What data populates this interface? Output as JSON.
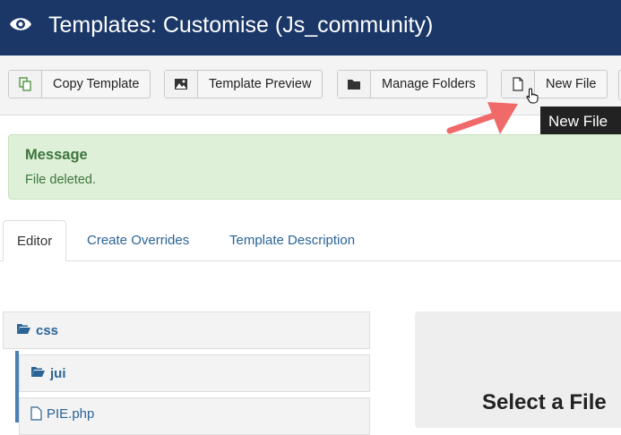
{
  "header": {
    "title": "Templates: Customise (Js_community)",
    "icon": "eye-icon"
  },
  "toolbar": {
    "buttons": [
      {
        "label": "Copy Template",
        "icon": "copy-icon"
      },
      {
        "label": "Template Preview",
        "icon": "image-icon"
      },
      {
        "label": "Manage Folders",
        "icon": "folder-icon"
      },
      {
        "label": "New File",
        "icon": "file-icon"
      }
    ]
  },
  "tooltip": {
    "text": "New File"
  },
  "alert": {
    "heading": "Message",
    "text": "File deleted."
  },
  "tabs": [
    {
      "label": "Editor",
      "active": true
    },
    {
      "label": "Create Overrides",
      "active": false
    },
    {
      "label": "Template Description",
      "active": false
    }
  ],
  "tree": {
    "items": [
      {
        "label": "css",
        "icon": "folder-open-icon"
      },
      {
        "label": "jui",
        "icon": "folder-open-icon"
      },
      {
        "label": "PIE.php",
        "icon": "file-icon"
      }
    ]
  },
  "main": {
    "placeholder_heading": "Select a File"
  },
  "colors": {
    "header_bg": "#1a3767",
    "alert_bg": "#dff0d8",
    "alert_text": "#3c763d",
    "link": "#2a6496",
    "annotation_arrow": "#f16a6a"
  }
}
